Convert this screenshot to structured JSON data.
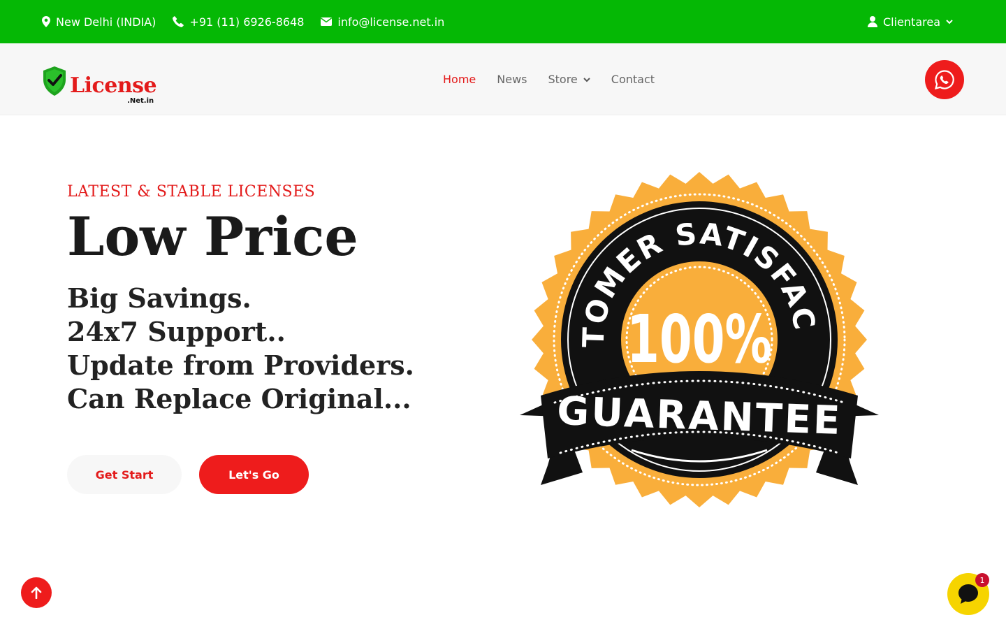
{
  "topbar": {
    "location": "New Delhi (INDIA)",
    "phone": "+91 (11) 6926-8648",
    "email": "info@license.net.in",
    "clientarea": "Clientarea",
    "icons": [
      "map-marker-icon",
      "phone-icon",
      "envelope-icon",
      "user-icon",
      "chevron-down-icon"
    ]
  },
  "logo": {
    "name": "License",
    "suffix": ".Net.in"
  },
  "nav": {
    "items": [
      {
        "label": "Home",
        "active": true
      },
      {
        "label": "News",
        "active": false
      },
      {
        "label": "Store",
        "active": false,
        "has_dropdown": true
      },
      {
        "label": "Contact",
        "active": false
      }
    ]
  },
  "hero": {
    "eyebrow": "LATEST & STABLE LICENSES",
    "title": "Low Price",
    "features": [
      "Big Savings.",
      "24x7 Support..",
      "Update from Providers.",
      "Can Replace Original..."
    ],
    "btn_primary": "Get Start",
    "btn_secondary": "Let's Go"
  },
  "badge": {
    "top_text": "CUSTOMER SATISFACTION",
    "center_text": "100%",
    "ribbon_text": "GUARANTEE"
  },
  "chat": {
    "unread": "1"
  },
  "colors": {
    "green": "#05b805",
    "red": "#ee1c1c",
    "accent": "#e31b1b",
    "badge_orange": "#f9ae3b",
    "chat_yellow": "#f6d400"
  }
}
